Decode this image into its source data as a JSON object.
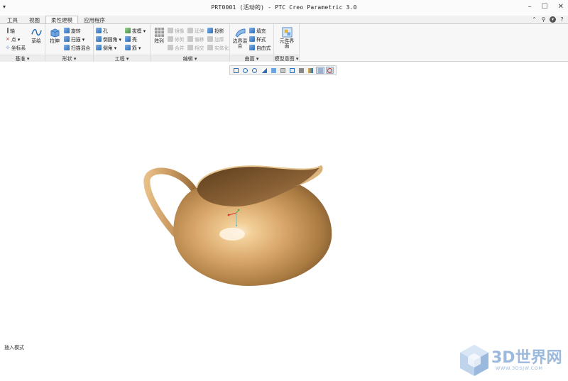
{
  "window": {
    "title": "PRT0001 (活动的) - PTC Creo Parametric 3.0",
    "quick_access": "▾"
  },
  "tabs": [
    "工具",
    "视图",
    "柔性建模",
    "应用程序"
  ],
  "active_tab": "柔性建模",
  "groups": {
    "datum": {
      "label": "基准 ▾",
      "items": [
        "轴",
        "点 ▾",
        "坐标系"
      ],
      "sketch": "草绘"
    },
    "shapes": {
      "label": "形状 ▾",
      "extrude": "拉伸",
      "items": [
        "旋转",
        "扫描 ▾",
        "扫描混合"
      ]
    },
    "engineering": {
      "label": "工程 ▾",
      "items_left": [
        "孔",
        "倒圆角 ▾",
        "倒角 ▾"
      ],
      "items_right": [
        "拔模 ▾",
        "壳",
        "筋 ▾"
      ]
    },
    "editing": {
      "label": "编辑 ▾",
      "pattern": "阵列",
      "items": [
        "镜像",
        "延伸",
        "投影",
        "修剪",
        "偏移",
        "加厚",
        "合并",
        "相交",
        "实体化"
      ]
    },
    "surfaces": {
      "label": "曲面 ▾",
      "boundary_blend": "边界混合",
      "items": [
        "填充",
        "样式",
        "自由式"
      ]
    },
    "model_intent": {
      "label": "模型意图 ▾",
      "component_interface": "元件界面"
    }
  },
  "status_text": "插入模式",
  "watermark": {
    "title": "3D世界网",
    "url": "WWW.3DSJW.COM"
  },
  "colors": {
    "model_base": "#c99a62",
    "model_highlight": "#f4d9b0",
    "model_shadow": "#7a5530",
    "watermark": "#9bb9dc",
    "accent_blue": "#2d6cb8"
  }
}
